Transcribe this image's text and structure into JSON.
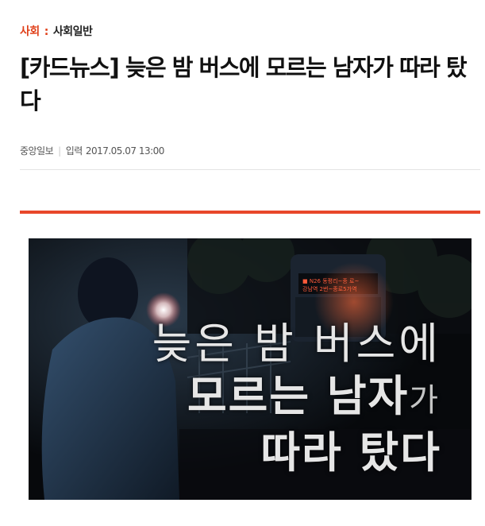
{
  "breadcrumb": {
    "section": "사회",
    "separator": ":",
    "subsection": "사회일반"
  },
  "article": {
    "title": "[카드뉴스] 늦은 밤 버스에 모르는 남자가 따라 탔다",
    "source": "중앙일보",
    "date_label": "입력",
    "date": "2017.05.07 13:00"
  },
  "hero": {
    "line1": "늦은 밤 버스에",
    "line2_bold": "모르는 남자",
    "line2_light": "가",
    "line3": "따라 탔다",
    "bus_sign_line1": "■ N26 동평리~종 로~",
    "bus_sign_line2": "강남역 2번~종로5가역"
  },
  "colors": {
    "accent": "#e8472a",
    "breadcrumb": "#e0401a"
  }
}
